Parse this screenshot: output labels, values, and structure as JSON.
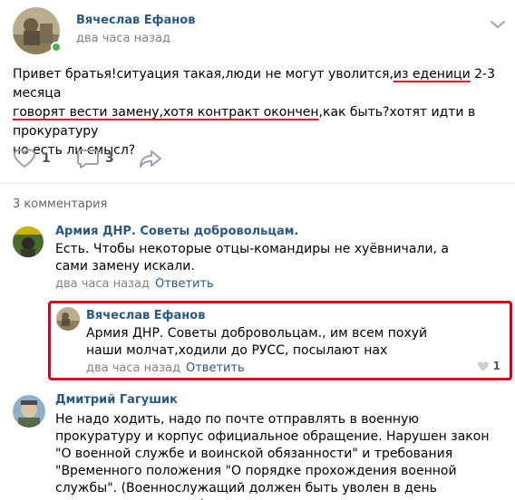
{
  "post": {
    "author": "Вячеслав Ефанов",
    "time": "два часа назад",
    "text_parts": [
      "Привет братья!ситуация такая,люди не могут уволится,",
      "из еденици",
      " 2-3 месяца",
      "говорят вести замену,хотя контракт окончен",
      ",как быть?хотят идти в прокуратуру",
      "но есть ли смысл?"
    ],
    "likes": "1",
    "comments": "3"
  },
  "comments_header": "3 комментария",
  "comments": [
    {
      "author": "Армия ДНР. Советы добровольцам.",
      "text": "Есть. Чтобы некоторые отцы-командиры не хуёвничали, а сами замену искали.",
      "time": "два часа назад",
      "reply_label": "Ответить"
    },
    {
      "author": "Вячеслав Ефанов",
      "text": "Армия ДНР. Советы добровольцам., им всем похуй наши молчат,ходили до РУСС, посылают нах",
      "time": "два часа назад",
      "reply_label": "Ответить",
      "likes": "1"
    },
    {
      "author": "Дмитрий Гагушик",
      "text": "Не надо ходить, надо по почте отправлять в военную прокуратуру и корпус официальное обращение. Нарушен закон \"О военной службе и воинской обязанности\" и требования \"Временного положения \"О порядке прохождения военной службы\". (Военнослужащий должен быть уволен в день окончания контракта)."
    }
  ],
  "colors": {
    "link": "#2a5885",
    "highlight": "#d8001a",
    "online": "#4bb34b"
  }
}
